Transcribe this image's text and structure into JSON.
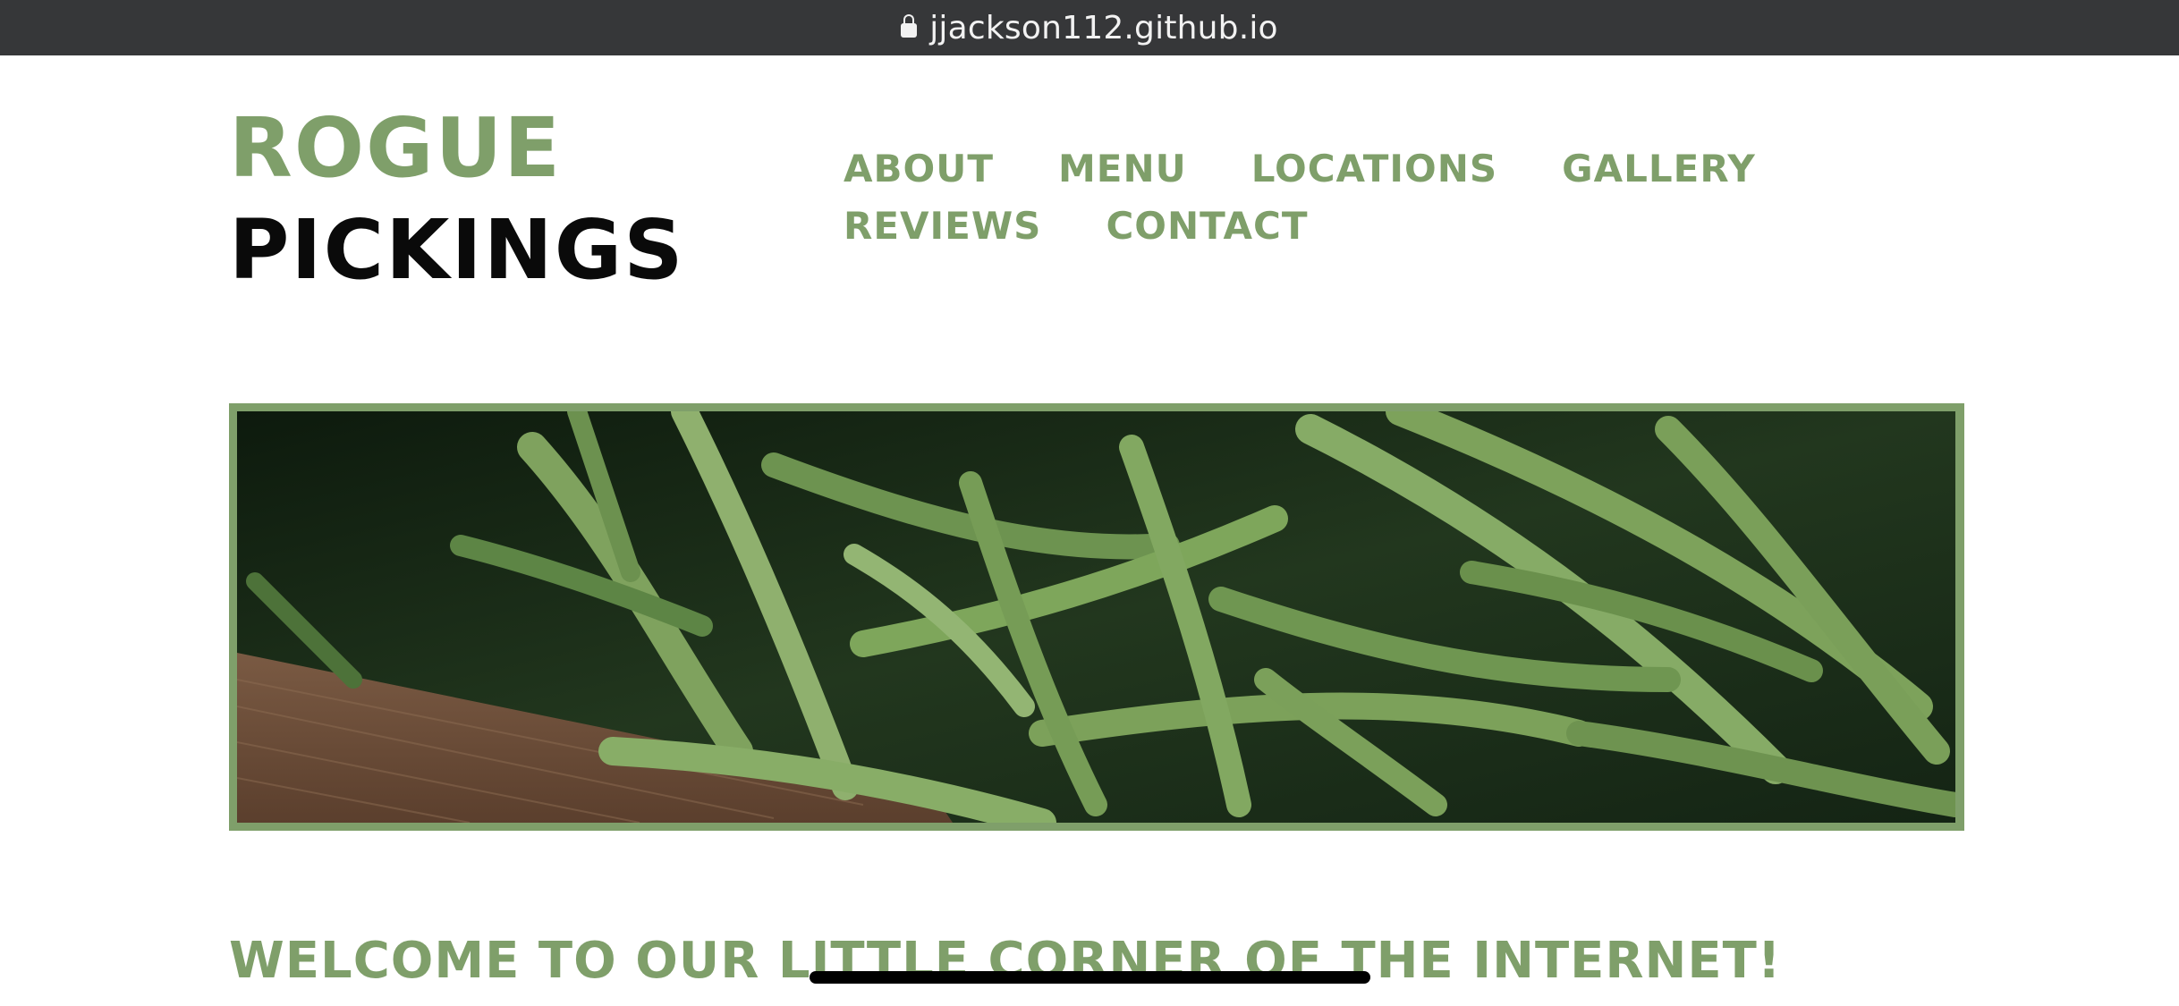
{
  "browser": {
    "url": "jjackson112.github.io",
    "lock_icon": "lock-icon"
  },
  "logo": {
    "line1": "ROGUE",
    "line2": "PICKINGS"
  },
  "nav": {
    "items": [
      {
        "label": "ABOUT"
      },
      {
        "label": "MENU"
      },
      {
        "label": "LOCATIONS"
      },
      {
        "label": "GALLERY"
      },
      {
        "label": "REVIEWS"
      },
      {
        "label": "CONTACT"
      }
    ]
  },
  "hero": {
    "image_name": "green-beans-photo"
  },
  "main": {
    "welcome_heading": "WELCOME TO OUR LITTLE CORNER OF THE INTERNET!"
  },
  "colors": {
    "accent": "#7f9f6a",
    "url_bar": "#363739",
    "text_dark": "#0a0a0a"
  }
}
